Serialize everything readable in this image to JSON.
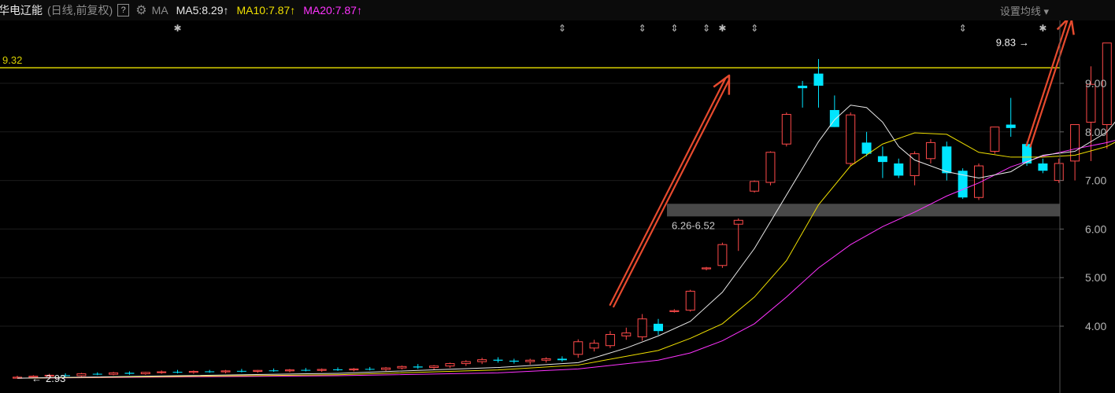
{
  "header": {
    "stock_name": "华电辽能",
    "mode": "(日线,前复权)",
    "help": "?",
    "ma_label": "MA",
    "ma5": "MA5:8.29",
    "ma10": "MA10:7.87",
    "ma20": "MA20:7.87",
    "arrow": "↑",
    "settings": "设置均线",
    "settings_caret": "▾"
  },
  "colors": {
    "up": "#ff4a4a",
    "down": "#00e5ff",
    "ma5": "#e8e8e8",
    "ma10": "#f0e000",
    "ma20": "#ff33ff",
    "level_line": "#d8d000",
    "arrow": "#e64a2e",
    "support_band": "#555555"
  },
  "chart_data": {
    "type": "candlestick",
    "y_axis_ticks": [
      "4.00",
      "5.00",
      "6.00",
      "7.00",
      "8.00",
      "9.00"
    ],
    "ylim": [
      2.6,
      10.3
    ],
    "annotations": {
      "level_line": {
        "value": 9.32,
        "label": "9.32"
      },
      "high": {
        "value": 9.83,
        "label": "9.83"
      },
      "low": {
        "value": 2.93,
        "label": "2.93"
      },
      "support_band": {
        "low": 6.26,
        "high": 6.52,
        "label": "6.26-6.52"
      }
    },
    "candles": [
      [
        2.93,
        2.98,
        2.93,
        2.95
      ],
      [
        2.95,
        2.99,
        2.93,
        2.97
      ],
      [
        2.97,
        3.02,
        2.95,
        2.99
      ],
      [
        2.99,
        3.03,
        2.96,
        2.98
      ],
      [
        2.98,
        3.04,
        2.96,
        3.02
      ],
      [
        3.02,
        3.05,
        2.99,
        3.01
      ],
      [
        3.01,
        3.06,
        2.99,
        3.04
      ],
      [
        3.04,
        3.07,
        3.0,
        3.02
      ],
      [
        3.02,
        3.06,
        3.0,
        3.05
      ],
      [
        3.05,
        3.09,
        3.02,
        3.06
      ],
      [
        3.06,
        3.1,
        3.03,
        3.05
      ],
      [
        3.05,
        3.09,
        3.02,
        3.07
      ],
      [
        3.07,
        3.1,
        3.04,
        3.06
      ],
      [
        3.06,
        3.1,
        3.03,
        3.08
      ],
      [
        3.08,
        3.12,
        3.05,
        3.07
      ],
      [
        3.07,
        3.1,
        3.04,
        3.09
      ],
      [
        3.09,
        3.13,
        3.06,
        3.08
      ],
      [
        3.08,
        3.12,
        3.05,
        3.1
      ],
      [
        3.1,
        3.14,
        3.07,
        3.09
      ],
      [
        3.09,
        3.13,
        3.06,
        3.11
      ],
      [
        3.11,
        3.15,
        3.08,
        3.1
      ],
      [
        3.1,
        3.14,
        3.07,
        3.12
      ],
      [
        3.12,
        3.16,
        3.09,
        3.11
      ],
      [
        3.11,
        3.16,
        3.08,
        3.14
      ],
      [
        3.14,
        3.19,
        3.11,
        3.17
      ],
      [
        3.17,
        3.22,
        3.12,
        3.15
      ],
      [
        3.15,
        3.2,
        3.11,
        3.18
      ],
      [
        3.18,
        3.25,
        3.14,
        3.23
      ],
      [
        3.23,
        3.3,
        3.18,
        3.27
      ],
      [
        3.27,
        3.35,
        3.22,
        3.31
      ],
      [
        3.31,
        3.36,
        3.25,
        3.29
      ],
      [
        3.29,
        3.33,
        3.23,
        3.27
      ],
      [
        3.27,
        3.33,
        3.21,
        3.3
      ],
      [
        3.3,
        3.36,
        3.25,
        3.33
      ],
      [
        3.33,
        3.38,
        3.27,
        3.3
      ],
      [
        3.42,
        3.73,
        3.35,
        3.68
      ],
      [
        3.55,
        3.72,
        3.48,
        3.65
      ],
      [
        3.6,
        3.9,
        3.55,
        3.83
      ],
      [
        3.8,
        3.97,
        3.72,
        3.86
      ],
      [
        3.78,
        4.25,
        3.7,
        4.15
      ],
      [
        4.05,
        4.15,
        3.82,
        3.9
      ],
      [
        4.3,
        4.35,
        4.28,
        4.32
      ],
      [
        4.33,
        4.75,
        4.3,
        4.72
      ],
      [
        5.18,
        5.22,
        5.15,
        5.2
      ],
      [
        5.25,
        5.72,
        5.2,
        5.68
      ],
      [
        6.1,
        6.22,
        5.55,
        6.18
      ],
      [
        6.78,
        7.0,
        6.75,
        6.98
      ],
      [
        6.96,
        7.6,
        6.9,
        7.58
      ],
      [
        7.75,
        8.4,
        7.7,
        8.36
      ],
      [
        8.95,
        9.05,
        8.5,
        8.9
      ],
      [
        9.2,
        9.5,
        8.5,
        8.95
      ],
      [
        8.45,
        8.75,
        8.1,
        8.1
      ],
      [
        7.35,
        8.4,
        7.3,
        8.35
      ],
      [
        7.78,
        8.0,
        7.5,
        7.55
      ],
      [
        7.5,
        7.7,
        7.05,
        7.38
      ],
      [
        7.35,
        7.45,
        7.05,
        7.1
      ],
      [
        7.1,
        7.6,
        6.9,
        7.55
      ],
      [
        7.45,
        7.85,
        7.35,
        7.78
      ],
      [
        7.7,
        7.8,
        7.0,
        7.15
      ],
      [
        7.2,
        7.25,
        6.62,
        6.65
      ],
      [
        6.65,
        7.35,
        6.6,
        7.3
      ],
      [
        7.6,
        8.1,
        7.55,
        8.1
      ],
      [
        8.15,
        8.7,
        7.9,
        8.08
      ],
      [
        7.75,
        7.8,
        7.3,
        7.35
      ],
      [
        7.35,
        7.45,
        7.15,
        7.2
      ],
      [
        7.0,
        7.45,
        6.95,
        7.35
      ],
      [
        7.4,
        8.15,
        7.0,
        8.15
      ],
      [
        8.2,
        9.35,
        7.4,
        8.98
      ],
      [
        8.15,
        9.83,
        7.65,
        9.83
      ]
    ],
    "ma5": [
      [
        0,
        2.93
      ],
      [
        10,
        2.98
      ],
      [
        20,
        3.03
      ],
      [
        30,
        3.15
      ],
      [
        35,
        3.25
      ],
      [
        38,
        3.55
      ],
      [
        40,
        3.8
      ],
      [
        42,
        4.1
      ],
      [
        44,
        4.7
      ],
      [
        46,
        5.6
      ],
      [
        48,
        6.7
      ],
      [
        50,
        7.8
      ],
      [
        51,
        8.25
      ],
      [
        52,
        8.55
      ],
      [
        53,
        8.5
      ],
      [
        54,
        8.2
      ],
      [
        55,
        7.7
      ],
      [
        56,
        7.42
      ],
      [
        58,
        7.18
      ],
      [
        60,
        7.05
      ],
      [
        62,
        7.18
      ],
      [
        63,
        7.38
      ],
      [
        64,
        7.52
      ],
      [
        66,
        7.6
      ],
      [
        68,
        8.0
      ],
      [
        69,
        8.4
      ]
    ],
    "ma10": [
      [
        0,
        2.93
      ],
      [
        20,
        3.0
      ],
      [
        30,
        3.1
      ],
      [
        35,
        3.2
      ],
      [
        40,
        3.5
      ],
      [
        42,
        3.75
      ],
      [
        44,
        4.05
      ],
      [
        46,
        4.6
      ],
      [
        48,
        5.35
      ],
      [
        50,
        6.5
      ],
      [
        52,
        7.3
      ],
      [
        54,
        7.75
      ],
      [
        56,
        7.98
      ],
      [
        58,
        7.95
      ],
      [
        60,
        7.58
      ],
      [
        62,
        7.48
      ],
      [
        64,
        7.48
      ],
      [
        66,
        7.52
      ],
      [
        68,
        7.7
      ],
      [
        69,
        7.87
      ]
    ],
    "ma20": [
      [
        0,
        2.93
      ],
      [
        20,
        2.98
      ],
      [
        30,
        3.04
      ],
      [
        35,
        3.12
      ],
      [
        40,
        3.3
      ],
      [
        42,
        3.45
      ],
      [
        44,
        3.7
      ],
      [
        46,
        4.05
      ],
      [
        48,
        4.6
      ],
      [
        50,
        5.2
      ],
      [
        52,
        5.68
      ],
      [
        54,
        6.05
      ],
      [
        56,
        6.35
      ],
      [
        58,
        6.68
      ],
      [
        60,
        6.95
      ],
      [
        62,
        7.28
      ],
      [
        64,
        7.5
      ],
      [
        66,
        7.65
      ],
      [
        68,
        7.78
      ],
      [
        69,
        7.87
      ]
    ],
    "event_marks": [
      {
        "index": 10,
        "symbol": "✱"
      },
      {
        "index": 34,
        "symbol": "⇕"
      },
      {
        "index": 39,
        "symbol": "⇕"
      },
      {
        "index": 41,
        "symbol": "⇕"
      },
      {
        "index": 43,
        "symbol": "⇕"
      },
      {
        "index": 44,
        "symbol": "✱"
      },
      {
        "index": 46,
        "symbol": "⇕"
      },
      {
        "index": 59,
        "symbol": "⇕"
      },
      {
        "index": 64,
        "symbol": "✱"
      }
    ]
  }
}
